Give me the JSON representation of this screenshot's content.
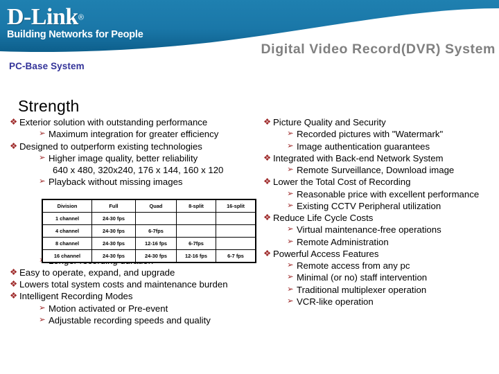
{
  "header": {
    "logo_wordmark": "D-Link",
    "logo_registered": "®",
    "logo_tagline": "Building Networks for People",
    "slide_title": "Digital Video Record(DVR) System",
    "subtitle": "PC-Base System",
    "banner_color": "#1a77a8",
    "banner_color_dark": "#0d5f8c",
    "title_color": "#808080",
    "subtitle_color": "#333399"
  },
  "body": {
    "heading": "Strength",
    "bullet_marker": "❖",
    "arrow_marker": "➢",
    "marker_color": "#9e2a2a"
  },
  "left_column": {
    "items": [
      {
        "level": 1,
        "text": "Exterior solution with outstanding performance"
      },
      {
        "level": 2,
        "text": "Maximum integration for greater efficiency"
      },
      {
        "level": 1,
        "text": "Designed to outperform existing technologies"
      },
      {
        "level": 2,
        "text": "Higher image quality, better reliability"
      },
      {
        "level": 0,
        "text": "640 x 480, 320x240, 176 x 144, 160 x 120"
      },
      {
        "level": 2,
        "text": "Playback without missing images"
      }
    ],
    "items_after_table": [
      {
        "level": 2,
        "text": "Longer recording duration"
      },
      {
        "level": 1,
        "text": "Easy to operate, expand, and upgrade"
      },
      {
        "level": 1,
        "text": "Lowers total system costs and maintenance burden"
      },
      {
        "level": 1,
        "text": "Intelligent Recording Modes"
      },
      {
        "level": 2,
        "text": "Motion activated or Pre-event"
      },
      {
        "level": 2,
        "text": "Adjustable recording speeds and quality"
      }
    ]
  },
  "right_column": {
    "items": [
      {
        "level": 1,
        "text": "Picture Quality and Security"
      },
      {
        "level": 2,
        "text": "Recorded pictures with \"Watermark\""
      },
      {
        "level": 2,
        "text": "Image authentication guarantees"
      },
      {
        "level": 1,
        "text": "Integrated with Back-end Network System"
      },
      {
        "level": 2,
        "text": "Remote Surveillance, Download image"
      },
      {
        "level": 1,
        "text": "Lower the Total Cost of Recording"
      },
      {
        "level": 2,
        "text": "Reasonable price with excellent performance"
      },
      {
        "level": 2,
        "text": "Existing CCTV Peripheral utilization"
      },
      {
        "level": 1,
        "text": "Reduce Life Cycle Costs"
      },
      {
        "level": 2,
        "text": "Virtual maintenance-free operations"
      },
      {
        "level": 2,
        "text": "Remote Administration"
      },
      {
        "level": 1,
        "text": "Powerful Access Features"
      },
      {
        "level": 2,
        "text": "Remote access from any pc"
      },
      {
        "level": 2,
        "text": "Minimal (or no) staff intervention"
      },
      {
        "level": 2,
        "text": "Traditional multiplexer operation"
      },
      {
        "level": 2,
        "text": "VCR-like operation"
      }
    ]
  },
  "fps_table": {
    "headers": [
      "Division",
      "Full",
      "Quad",
      "8-split",
      "16-split"
    ],
    "rows": [
      [
        "1 channel",
        "24-30 fps",
        "",
        "",
        ""
      ],
      [
        "4 channel",
        "24-30 fps",
        "6-7fps",
        "",
        ""
      ],
      [
        "8 channel",
        "24-30 fps",
        "12-16 fps",
        "6-7fps",
        ""
      ],
      [
        "16 channel",
        "24-30 fps",
        "24-30 fps",
        "12-16 fps",
        "6-7 fps"
      ]
    ]
  }
}
